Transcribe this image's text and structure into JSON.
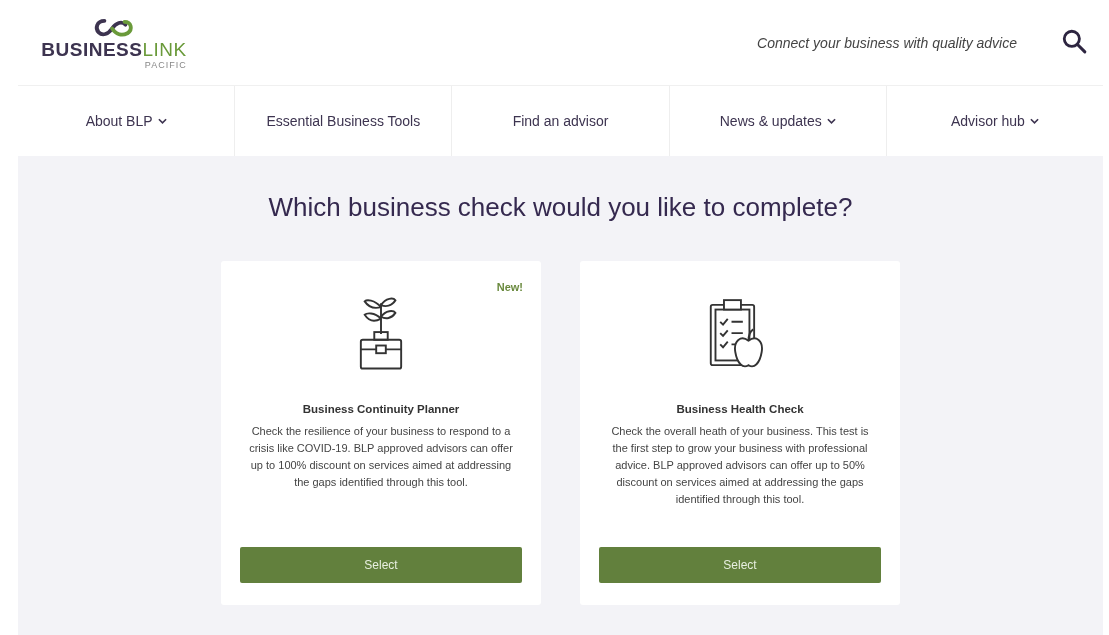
{
  "header": {
    "logo": {
      "word_1": "BUSINESS",
      "word_2": "LINK",
      "subtitle": "PACIFIC"
    },
    "tagline": "Connect your business with quality advice"
  },
  "nav": [
    {
      "label": "About BLP",
      "dropdown": true
    },
    {
      "label": "Essential Business Tools",
      "dropdown": false
    },
    {
      "label": "Find an advisor",
      "dropdown": false
    },
    {
      "label": "News & updates",
      "dropdown": true
    },
    {
      "label": "Advisor hub",
      "dropdown": true
    }
  ],
  "heading": "Which business check would you like to complete?",
  "cards": [
    {
      "kind": "plant",
      "badge": "New!",
      "title": "Business Continuity Planner",
      "description": "Check the resilience of your business to respond to a crisis like COVID-19. BLP approved advisors can offer up to 100% discount on services aimed at addressing the gaps identified through this tool.",
      "button": "Select"
    },
    {
      "kind": "clipboard",
      "title": "Business Health Check",
      "description": "Check the overall heath of your business. This test is the first step to grow your business with professional advice. BLP approved advisors can offer up to 50% discount on services aimed at addressing the gaps identified through this tool.",
      "button": "Select"
    }
  ]
}
